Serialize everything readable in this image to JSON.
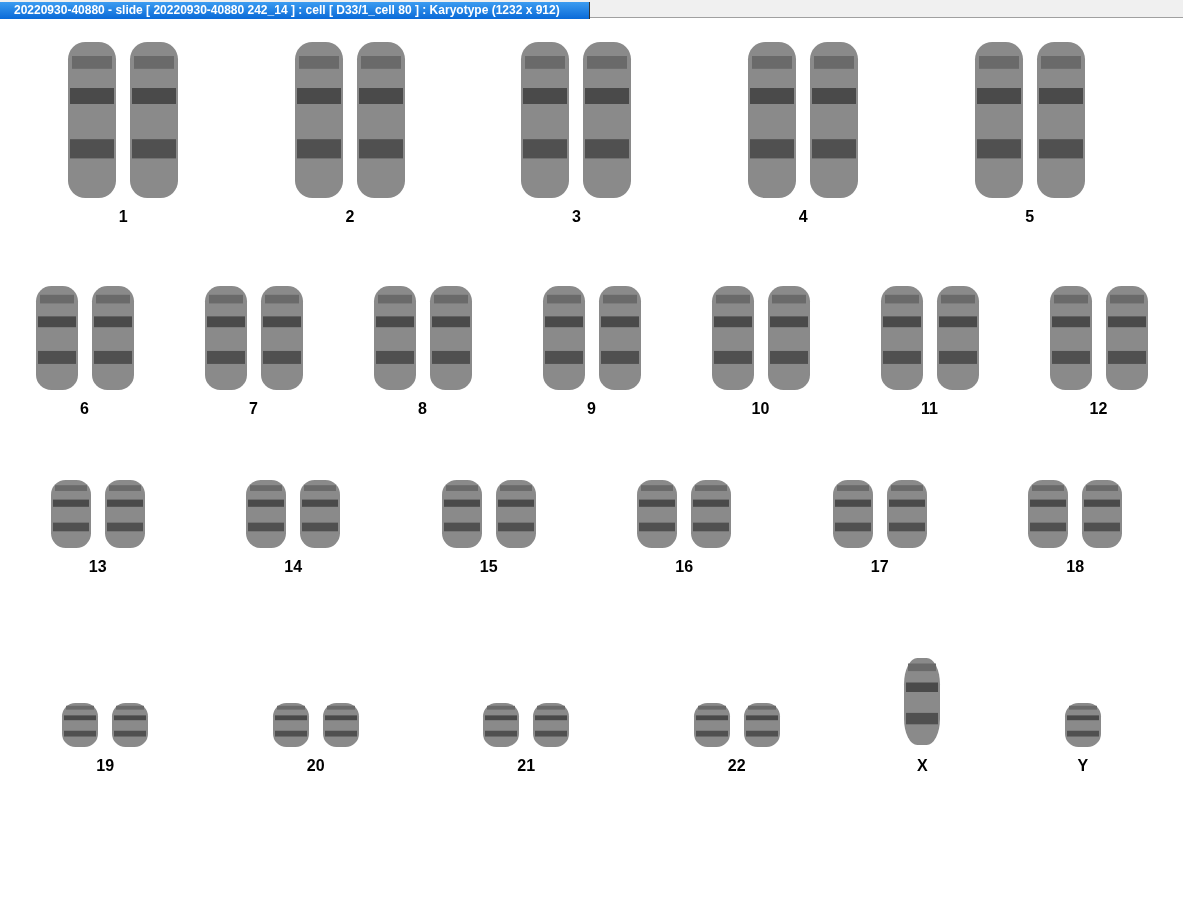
{
  "window": {
    "title": "20220930-40880 - slide [ 20220930-40880 242_14 ] : cell [ D33/1_cell 80 ] : Karyotype  (1232 x 912)"
  },
  "karyotype": {
    "rows": [
      [
        {
          "label": "1",
          "kind": "pair"
        },
        {
          "label": "2",
          "kind": "pair"
        },
        {
          "label": "3",
          "kind": "pair"
        },
        {
          "label": "4",
          "kind": "pair"
        },
        {
          "label": "5",
          "kind": "pair"
        }
      ],
      [
        {
          "label": "6",
          "kind": "pair"
        },
        {
          "label": "7",
          "kind": "pair"
        },
        {
          "label": "8",
          "kind": "pair"
        },
        {
          "label": "9",
          "kind": "pair"
        },
        {
          "label": "10",
          "kind": "pair"
        },
        {
          "label": "11",
          "kind": "pair"
        },
        {
          "label": "12",
          "kind": "pair"
        }
      ],
      [
        {
          "label": "13",
          "kind": "pair"
        },
        {
          "label": "14",
          "kind": "pair"
        },
        {
          "label": "15",
          "kind": "pair"
        },
        {
          "label": "16",
          "kind": "pair"
        },
        {
          "label": "17",
          "kind": "pair"
        },
        {
          "label": "18",
          "kind": "pair"
        }
      ],
      [
        {
          "label": "19",
          "kind": "pair"
        },
        {
          "label": "20",
          "kind": "pair"
        },
        {
          "label": "21",
          "kind": "pair"
        },
        {
          "label": "22",
          "kind": "pair"
        },
        {
          "label": "X",
          "kind": "single"
        },
        {
          "label": "Y",
          "kind": "single"
        }
      ]
    ]
  }
}
